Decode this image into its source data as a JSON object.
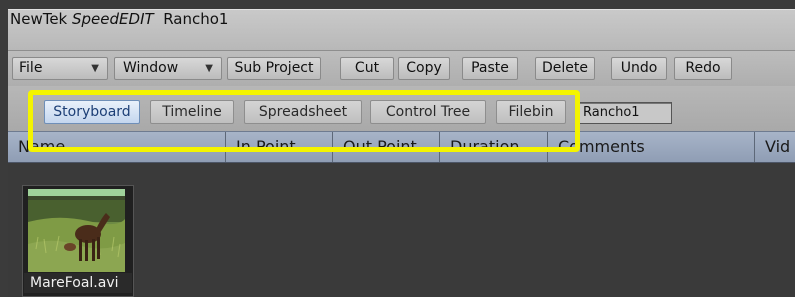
{
  "window": {
    "title_brand": "NewTek ",
    "title_product": "SpeedEDIT",
    "title_project": "  Rancho1"
  },
  "toolbar": {
    "file_label": "File",
    "window_label": "Window",
    "sub_project_label": "Sub Project",
    "cut_label": "Cut",
    "copy_label": "Copy",
    "paste_label": "Paste",
    "delete_label": "Delete",
    "undo_label": "Undo",
    "redo_label": "Redo"
  },
  "tabs": [
    {
      "label": "Storyboard",
      "active": true
    },
    {
      "label": "Timeline",
      "active": false
    },
    {
      "label": "Spreadsheet",
      "active": false
    },
    {
      "label": "Control Tree",
      "active": false
    },
    {
      "label": "Filebin",
      "active": false
    }
  ],
  "project_field": "Rancho1",
  "columns": [
    "Name",
    "In Point",
    "Out Point",
    "Duration",
    "Comments",
    "Vid"
  ],
  "clip": {
    "name": "MareFoal.avi"
  },
  "highlight_color": "#f4f400"
}
